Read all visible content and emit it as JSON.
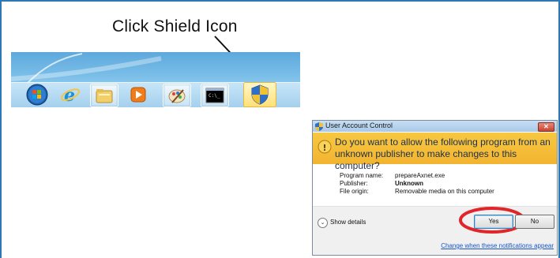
{
  "instruction": {
    "text": "Click Shield Icon"
  },
  "taskbar": {
    "items": [
      {
        "name": "start-orb",
        "icon": "windows-logo-icon"
      },
      {
        "name": "internet-explorer",
        "icon": "internet-explorer-icon"
      },
      {
        "name": "file-explorer",
        "icon": "folder-icon"
      },
      {
        "name": "media-player",
        "icon": "media-player-icon"
      },
      {
        "name": "paint",
        "icon": "paint-palette-icon"
      },
      {
        "name": "command-prompt",
        "icon": "command-prompt-icon"
      },
      {
        "name": "shield",
        "icon": "uac-shield-icon"
      }
    ]
  },
  "uac_dialog": {
    "title": "User Account Control",
    "close_label": "✕",
    "question": "Do you want to allow the following program from an unknown publisher to make changes to this computer?",
    "program_name_label": "Program name:",
    "program_name_value": "prepareAxnet.exe",
    "publisher_label": "Publisher:",
    "publisher_value": "Unknown",
    "file_origin_label": "File origin:",
    "file_origin_value": "Removable media on this computer",
    "show_details_label": "Show details",
    "yes_label": "Yes",
    "no_label": "No",
    "notifications_link": "Change when these notifications appear"
  },
  "colors": {
    "frame": "#2b78b8",
    "highlight_oval": "#e0252b",
    "banner": "#f2b430",
    "link": "#1a55c8"
  }
}
